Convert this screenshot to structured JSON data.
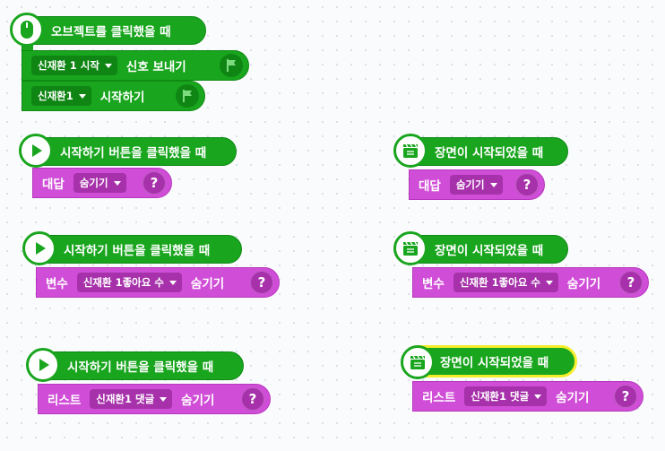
{
  "canvas": {
    "stack1": {
      "hat_label": "오브젝트를 클릭했을 때",
      "row1": {
        "dropdown": "신재환 1 시작",
        "text": "신호 보내기"
      },
      "row2": {
        "dropdown": "신재환1",
        "text": "시작하기"
      }
    },
    "stack2": {
      "hat_label": "시작하기 버튼을 클릭했을 때",
      "row": {
        "prefix": "대답",
        "dropdown": "숨기기",
        "help": "?"
      }
    },
    "stack3": {
      "hat_label": "장면이 시작되었을 때",
      "row": {
        "prefix": "대답",
        "dropdown": "숨기기",
        "help": "?"
      }
    },
    "stack4": {
      "hat_label": "시작하기 버튼을 클릭했을 때",
      "row": {
        "prefix": "변수",
        "dropdown": "신재환 1좋아요 수",
        "suffix": "숨기기",
        "help": "?"
      }
    },
    "stack5": {
      "hat_label": "장면이 시작되었을 때",
      "row": {
        "prefix": "변수",
        "dropdown": "신재환 1좋아요 수",
        "suffix": "숨기기",
        "help": "?"
      }
    },
    "stack6": {
      "hat_label": "시작하기 버튼을 클릭했을 때",
      "row": {
        "prefix": "리스트",
        "dropdown": "신재환1 댓글",
        "suffix": "숨기기",
        "help": "?"
      }
    },
    "stack7": {
      "hat_label": "장면이 시작되었을 때",
      "row": {
        "prefix": "리스트",
        "dropdown": "신재환1 댓글",
        "suffix": "숨기기",
        "help": "?"
      }
    }
  },
  "colors": {
    "start_block": "#19a51e",
    "looks_block": "#d04ed7"
  },
  "icons": {
    "mouse": "mouse-icon",
    "play": "play-icon",
    "scene": "clapperboard-icon",
    "flag": "flag-icon"
  }
}
